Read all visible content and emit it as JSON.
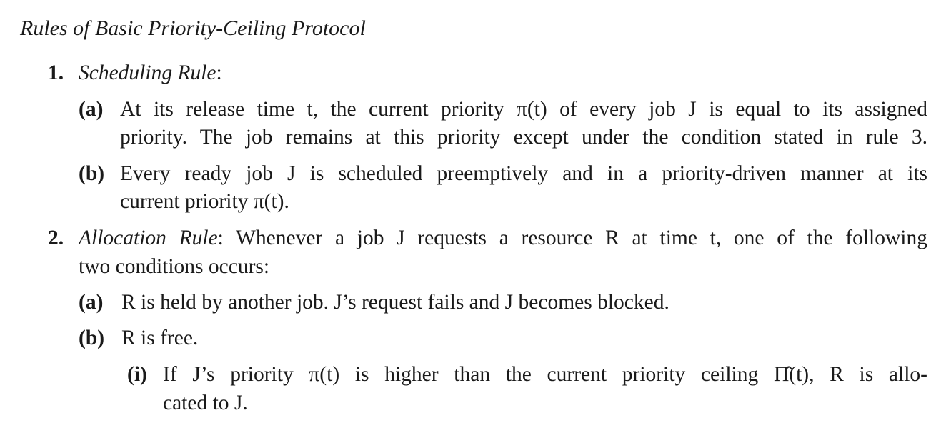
{
  "title": "Rules of Basic Priority-Ceiling Protocol",
  "rule1": {
    "number": "1.",
    "name": "Scheduling Rule",
    "name_suffix": ":",
    "a": {
      "label": "(a)",
      "line1": "At its release time t, the current priority π(t) of every job J is equal to its assigned",
      "line2": "priority. The job remains at this priority except under the condition stated in rule 3."
    },
    "b": {
      "label": "(b)",
      "line1": "Every ready job J is scheduled preemptively and in a priority-driven manner at its",
      "line2": "current priority π(t)."
    }
  },
  "rule2": {
    "number": "2.",
    "name": "Allocation Rule",
    "line1_rest": ": Whenever a job J requests a resource R at time t, one of the following",
    "line2": "two conditions occurs:",
    "a": {
      "label": "(a)",
      "text": "R is held by another job. J’s request fails and J becomes blocked."
    },
    "b": {
      "label": "(b)",
      "text": "R is free.",
      "i": {
        "label": "(i)",
        "line1": "If J’s priority π(t) is higher than the current priority ceiling Π̂(t), R is allo-",
        "line2": "cated to J."
      }
    }
  }
}
